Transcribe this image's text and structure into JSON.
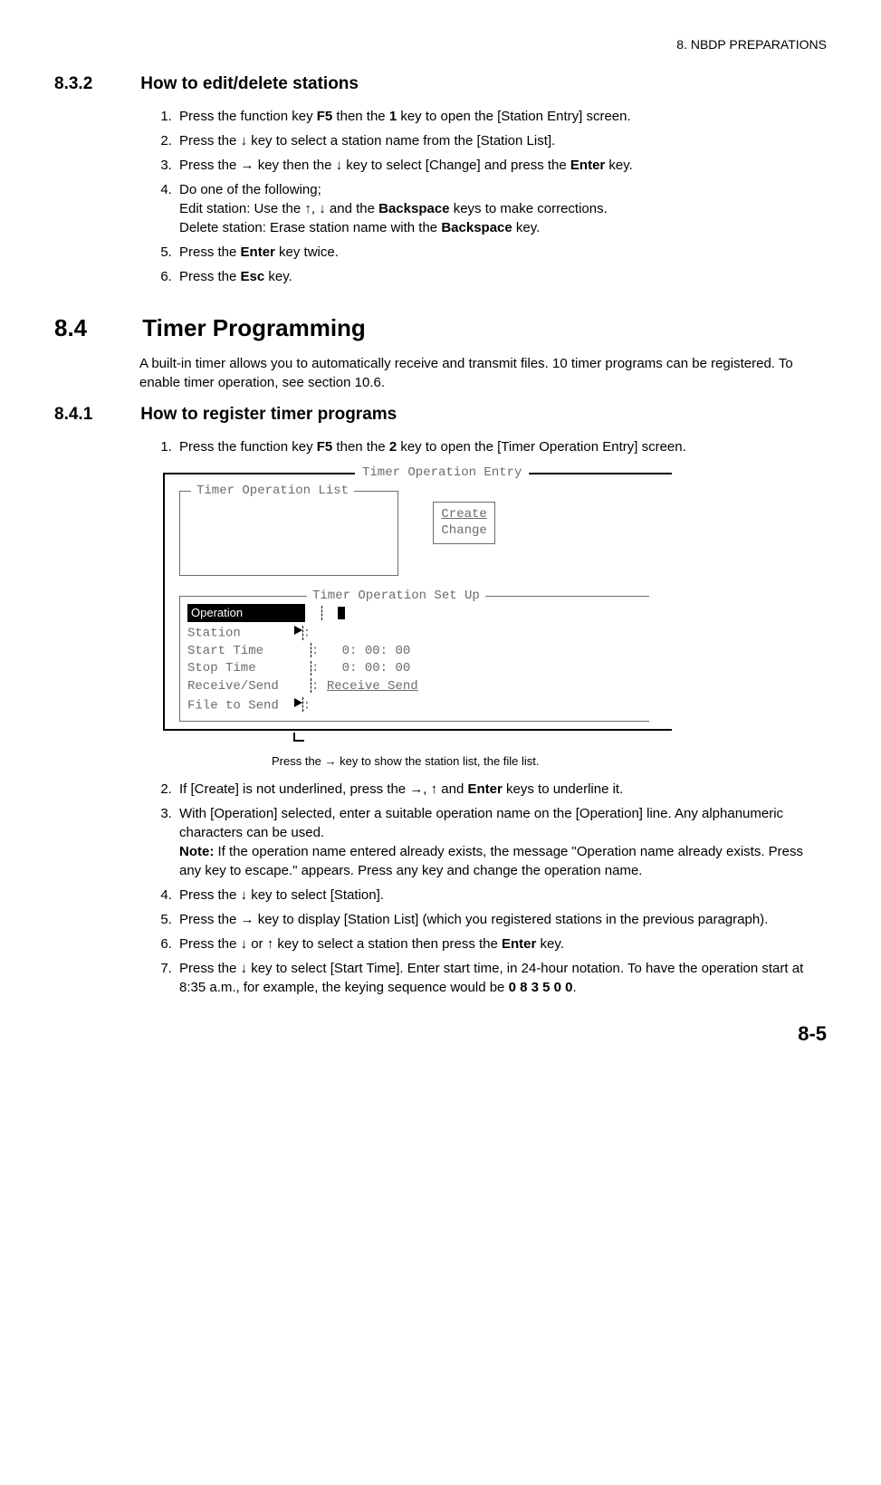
{
  "header": {
    "chapter": "8.  NBDP PREPARATIONS"
  },
  "s832": {
    "num": "8.3.2",
    "title": "How to edit/delete stations",
    "steps": [
      "Press the function key <b>F5</b> then the <b>1</b> key to open the [Station Entry] screen.",
      "Press the ↓ key to select a station name from the [Station List].",
      "Press the → key then the ↓ key to select [Change] and press the <b>Enter</b> key.",
      "Do one of the following;<br>Edit station: Use the ↑, ↓ and the <b>Backspace</b> keys to make corrections.<br>Delete station: Erase station name with the <b>Backspace</b> key.",
      "Press the <b>Enter</b> key twice.",
      "Press the <b>Esc</b> key."
    ]
  },
  "s84": {
    "num": "8.4",
    "title": "Timer Programming",
    "intro": "A built-in timer allows you to automatically receive and transmit files. 10 timer programs can be registered. To enable timer operation, see section 10.6."
  },
  "s841": {
    "num": "8.4.1",
    "title": "How to register timer programs",
    "step1": "Press the function key <b>F5</b> then the <b>2</b> key to open the [Timer Operation Entry] screen.",
    "figure": {
      "outer_title": "Timer Operation Entry",
      "list_title": "Timer Operation List",
      "side": {
        "create": "Create",
        "change": "Change"
      },
      "setup_title": "Timer Operation Set Up",
      "rows": {
        "operation": "Operation",
        "station": "Station",
        "start": "Start Time",
        "stop": "Stop Time",
        "start_val": " 0: 00: 00",
        "stop_val": " 0: 00: 00",
        "rs": "Receive/Send",
        "rs_val": "Receive Send",
        "file": "File to Send"
      },
      "caption": "Press the → key to show the station list, the file list."
    },
    "steps_after": [
      "If [Create] is not underlined, press the →, ↑ and <b>Enter</b> keys to underline it.",
      "With [Operation] selected, enter a suitable operation name on the [Operation] line. Any alphanumeric characters can be used.<br><b>Note:</b> If the operation name entered already exists, the message \"Operation name already exists. Press any key to escape.\" appears. Press any key and change the operation name.",
      "Press the ↓ key to select [Station].",
      "Press the → key to display [Station List] (which you registered stations in the previous paragraph).",
      "Press the ↓ or ↑ key to select a station then press the <b>Enter</b> key.",
      "Press the ↓ key to select [Start Time]. Enter start time, in 24-hour notation. To have the operation start at 8:35 a.m., for example, the keying sequence would be <b>0 8 3 5 0 0</b>."
    ]
  },
  "page": "8-5"
}
